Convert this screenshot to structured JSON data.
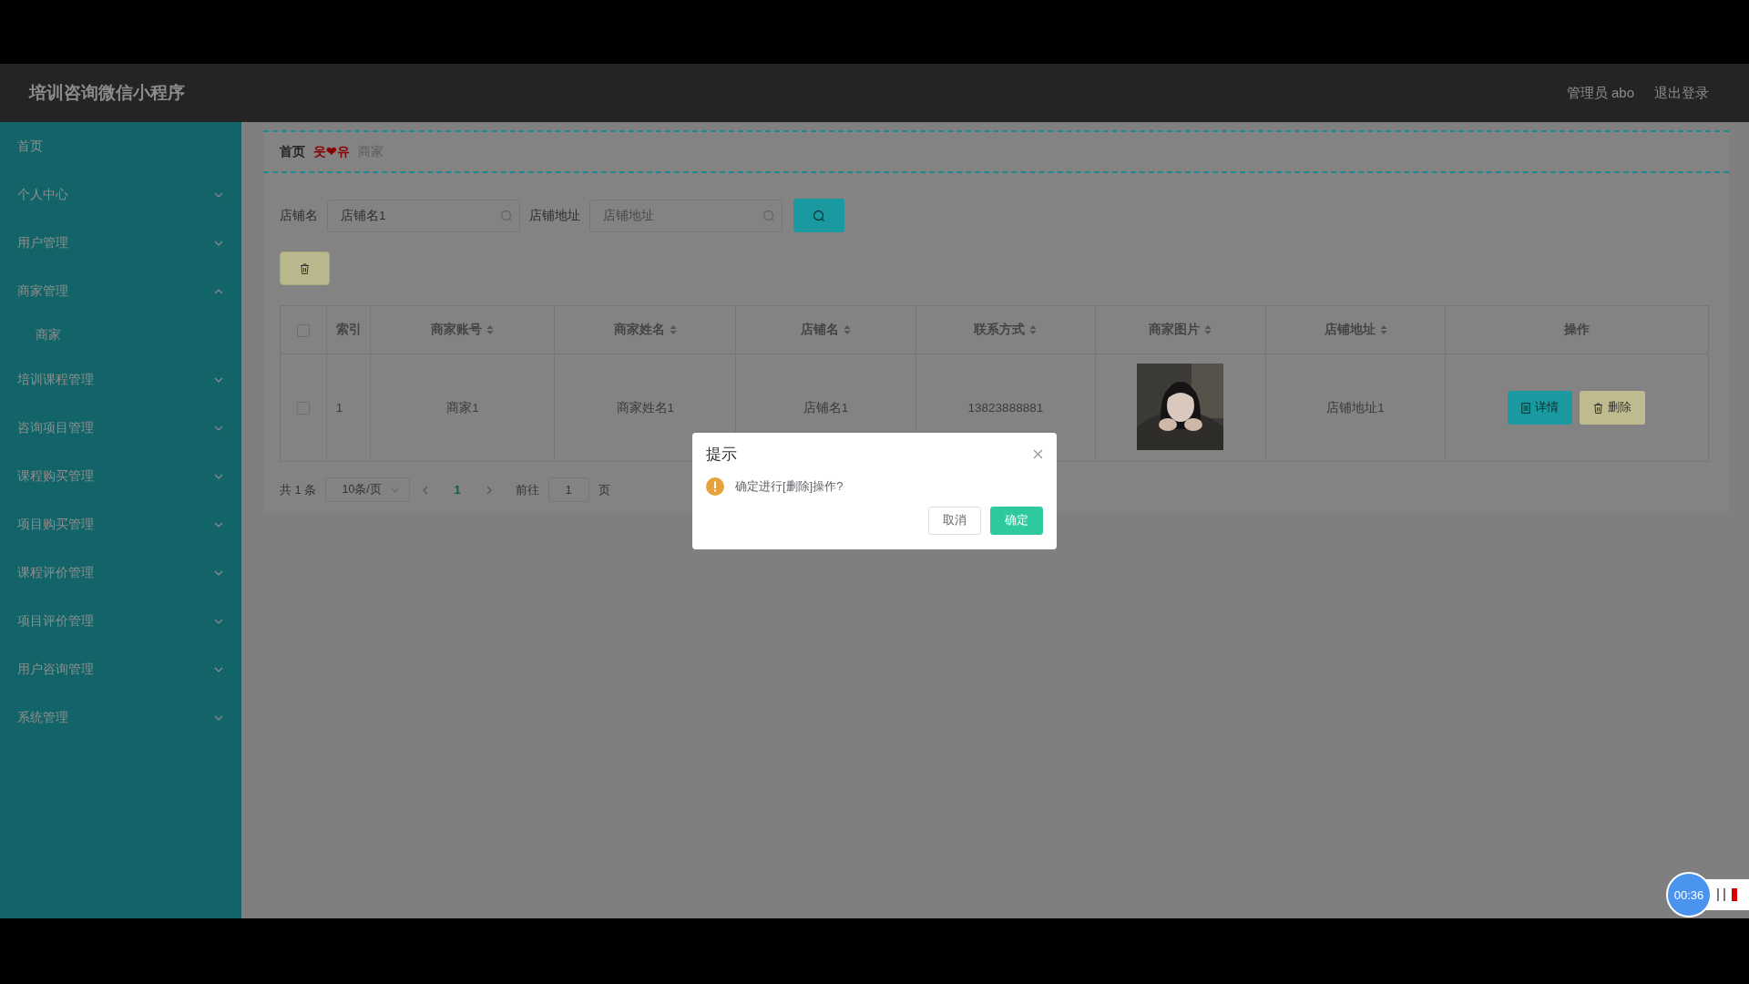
{
  "app": {
    "title": "培训咨询微信小程序"
  },
  "header": {
    "user": "管理员 abo",
    "logout": "退出登录"
  },
  "sidebar": {
    "items": [
      {
        "label": "首页",
        "kind": "link"
      },
      {
        "label": "个人中心",
        "kind": "menu",
        "expanded": false
      },
      {
        "label": "用户管理",
        "kind": "menu",
        "expanded": false
      },
      {
        "label": "商家管理",
        "kind": "menu",
        "expanded": true,
        "children": [
          {
            "label": "商家"
          }
        ]
      },
      {
        "label": "培训课程管理",
        "kind": "menu",
        "expanded": false
      },
      {
        "label": "咨询项目管理",
        "kind": "menu",
        "expanded": false
      },
      {
        "label": "课程购买管理",
        "kind": "menu",
        "expanded": false
      },
      {
        "label": "项目购买管理",
        "kind": "menu",
        "expanded": false
      },
      {
        "label": "课程评价管理",
        "kind": "menu",
        "expanded": false
      },
      {
        "label": "项目评价管理",
        "kind": "menu",
        "expanded": false
      },
      {
        "label": "用户咨询管理",
        "kind": "menu",
        "expanded": false
      },
      {
        "label": "系统管理",
        "kind": "menu",
        "expanded": false
      }
    ]
  },
  "breadcrumb": [
    {
      "label": "首页",
      "kind": "link"
    },
    {
      "label": "웃❤유",
      "kind": "separator"
    },
    {
      "label": "商家",
      "kind": "current"
    }
  ],
  "search": {
    "fields": [
      {
        "label": "店铺名",
        "value": "店铺名1"
      },
      {
        "label": "店铺地址",
        "placeholder": "店铺地址"
      }
    ]
  },
  "table": {
    "header_checked": false,
    "columns": [
      {
        "label": "索引",
        "sortable": false
      },
      {
        "label": "商家账号",
        "sortable": true
      },
      {
        "label": "商家姓名",
        "sortable": true
      },
      {
        "label": "店铺名",
        "sortable": true
      },
      {
        "label": "联系方式",
        "sortable": true
      },
      {
        "label": "商家图片",
        "sortable": true
      },
      {
        "label": "店铺地址",
        "sortable": true
      },
      {
        "label": "操作",
        "sortable": false
      }
    ],
    "rows": [
      {
        "selected": false,
        "index": "1",
        "account": "商家1",
        "name": "商家姓名1",
        "shop": "店铺名1",
        "phone": "13823888881",
        "address": "店铺地址1"
      }
    ],
    "actions": [
      {
        "label": "详情",
        "kind": "detail"
      },
      {
        "label": "删除",
        "kind": "delete"
      }
    ]
  },
  "pagination": {
    "total": "共 1 条",
    "page_size": "10条/页",
    "pages": [
      {
        "label": "1",
        "selected": true
      }
    ],
    "goto_label": "前往",
    "goto_value": "1",
    "goto_suffix": "页"
  },
  "dialog": {
    "title": "提示",
    "message": "确定进行[删除]操作?",
    "buttons": [
      {
        "label": "取消",
        "kind": "cancel"
      },
      {
        "label": "确定",
        "kind": "primary"
      }
    ]
  },
  "recorder": {
    "time": "00:36"
  }
}
